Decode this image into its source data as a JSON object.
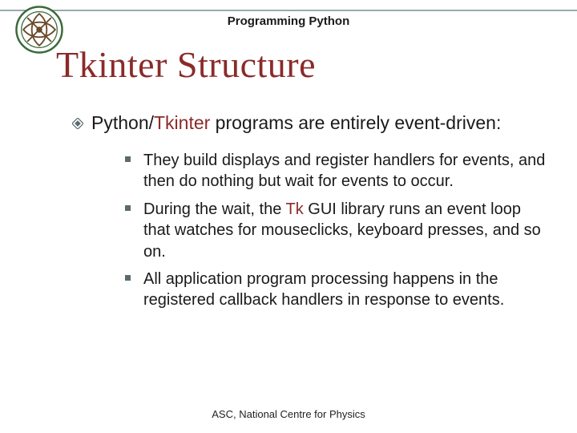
{
  "header": {
    "subject": "Programming Python"
  },
  "title": "Tkinter Structure",
  "main_point": {
    "pre": "Python/",
    "hi1": "Tkinter",
    "post": " programs are entirely event-driven:"
  },
  "subs": [
    {
      "plain": "They build displays and register handlers for events, and then do nothing but wait for events to occur."
    },
    {
      "pre": "During the wait, the ",
      "hi": "Tk",
      "post": " GUI library runs an event loop that watches for mouseclicks, keyboard presses, and so on."
    },
    {
      "plain": "All application program processing happens in the registered callback handlers in response to events."
    }
  ],
  "footer": "ASC, National Centre for Physics"
}
